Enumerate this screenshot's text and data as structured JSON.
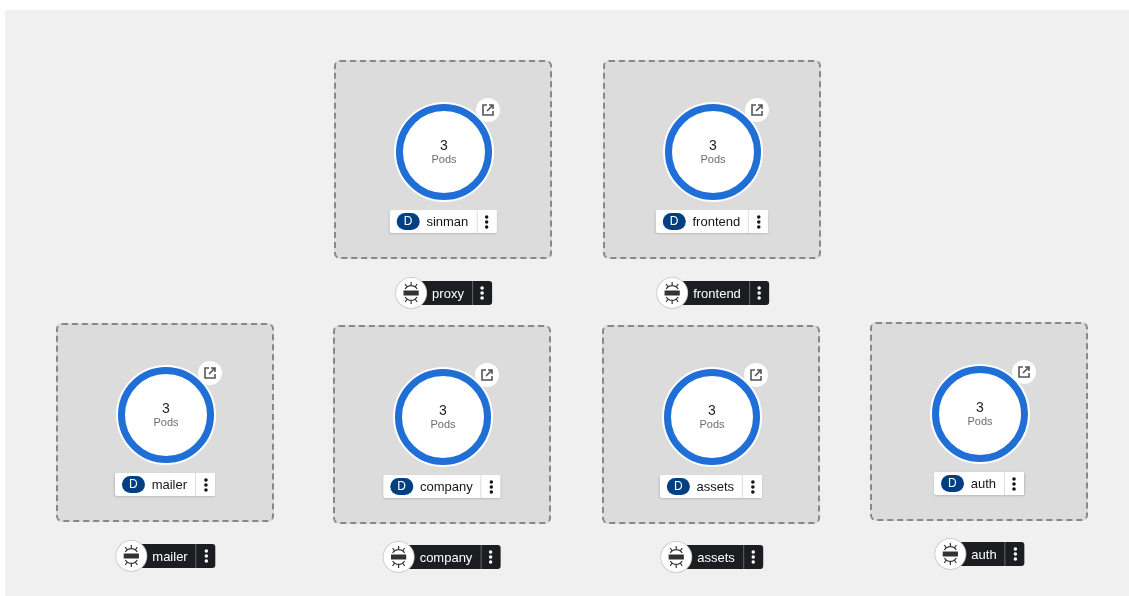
{
  "groups": [
    {
      "release": "proxy",
      "deployment": {
        "badge": "D",
        "name": "sinman"
      },
      "pods": {
        "count": "3",
        "unit": "Pods"
      }
    },
    {
      "release": "frontend",
      "deployment": {
        "badge": "D",
        "name": "frontend"
      },
      "pods": {
        "count": "3",
        "unit": "Pods"
      }
    },
    {
      "release": "mailer",
      "deployment": {
        "badge": "D",
        "name": "mailer"
      },
      "pods": {
        "count": "3",
        "unit": "Pods"
      }
    },
    {
      "release": "company",
      "deployment": {
        "badge": "D",
        "name": "company"
      },
      "pods": {
        "count": "3",
        "unit": "Pods"
      }
    },
    {
      "release": "assets",
      "deployment": {
        "badge": "D",
        "name": "assets"
      },
      "pods": {
        "count": "3",
        "unit": "Pods"
      }
    },
    {
      "release": "auth",
      "deployment": {
        "badge": "D",
        "name": "auth"
      },
      "pods": {
        "count": "3",
        "unit": "Pods"
      }
    }
  ]
}
